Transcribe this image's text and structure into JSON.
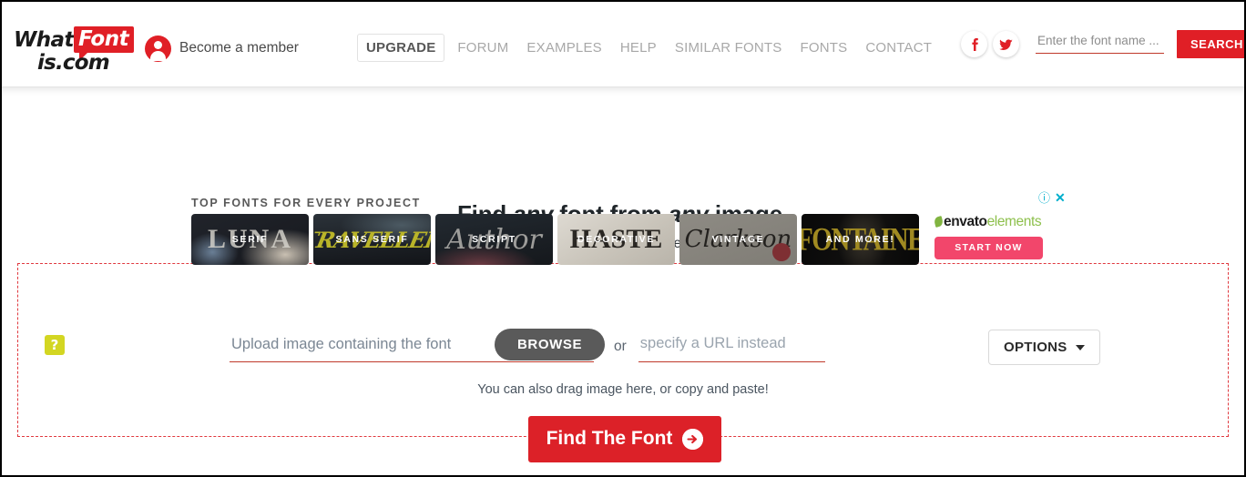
{
  "header": {
    "logo": {
      "part1": "What",
      "badge": "Font",
      "part2": "is.com"
    },
    "member": {
      "label": "Become a member",
      "icon": "user-circle-icon"
    },
    "nav": [
      {
        "label": "UPGRADE",
        "name": "upgrade",
        "active": true
      },
      {
        "label": "FORUM",
        "name": "forum"
      },
      {
        "label": "EXAMPLES",
        "name": "examples"
      },
      {
        "label": "HELP",
        "name": "help"
      },
      {
        "label": "SIMILAR FONTS",
        "name": "similar-fonts"
      },
      {
        "label": "FONTS",
        "name": "fonts"
      },
      {
        "label": "CONTACT",
        "name": "contact"
      }
    ],
    "social": [
      {
        "name": "facebook-icon",
        "glyph": "f"
      },
      {
        "name": "twitter-icon",
        "glyph": "t"
      }
    ],
    "search": {
      "placeholder": "Enter the font name ...",
      "value": "",
      "button_label": "SEARCH"
    }
  },
  "ad": {
    "title": "TOP FONTS FOR EVERY PROJECT",
    "cards": [
      {
        "label": "SERIF",
        "art": "LUNA"
      },
      {
        "label": "SANS SERIF",
        "art": "TRAVELLER"
      },
      {
        "label": "SCRIPT",
        "art": "Author"
      },
      {
        "label": "DECORATIVE",
        "art": "HASTE"
      },
      {
        "label": "VINTAGE",
        "art": "Clarkson"
      },
      {
        "label": "AND MORE!",
        "art": "FONTAINE"
      }
    ],
    "brand": {
      "word1": "envato",
      "word2": "elements"
    },
    "cta_label": "START NOW",
    "info_icon": "ⓘ",
    "close_icon": "✕"
  },
  "hero": {
    "title_part1": "Find ",
    "title_em1": "any",
    "title_part2": " font from ",
    "title_em2": "any",
    "title_part3": " image.",
    "subtitle": "(commercial or free)"
  },
  "form": {
    "help_icon_label": "?",
    "upload_placeholder": "Upload image containing the font",
    "browse_label": "BROWSE",
    "or_label": "or",
    "url_placeholder": "specify a URL instead",
    "url_value": "",
    "options_label": "OPTIONS",
    "drag_hint": "You can also drag image here, or copy and paste!",
    "submit_label": "Find The Font"
  },
  "colors": {
    "brand_red": "#e01f26",
    "submit_red": "#dc2128",
    "dashed_border": "#e0393f",
    "help_yellow": "#d3d622",
    "envato_pink": "#f2466b",
    "envato_green": "#8ec04d",
    "ad_control_blue": "#00aecc",
    "nav_muted": "#a8a8a8"
  }
}
